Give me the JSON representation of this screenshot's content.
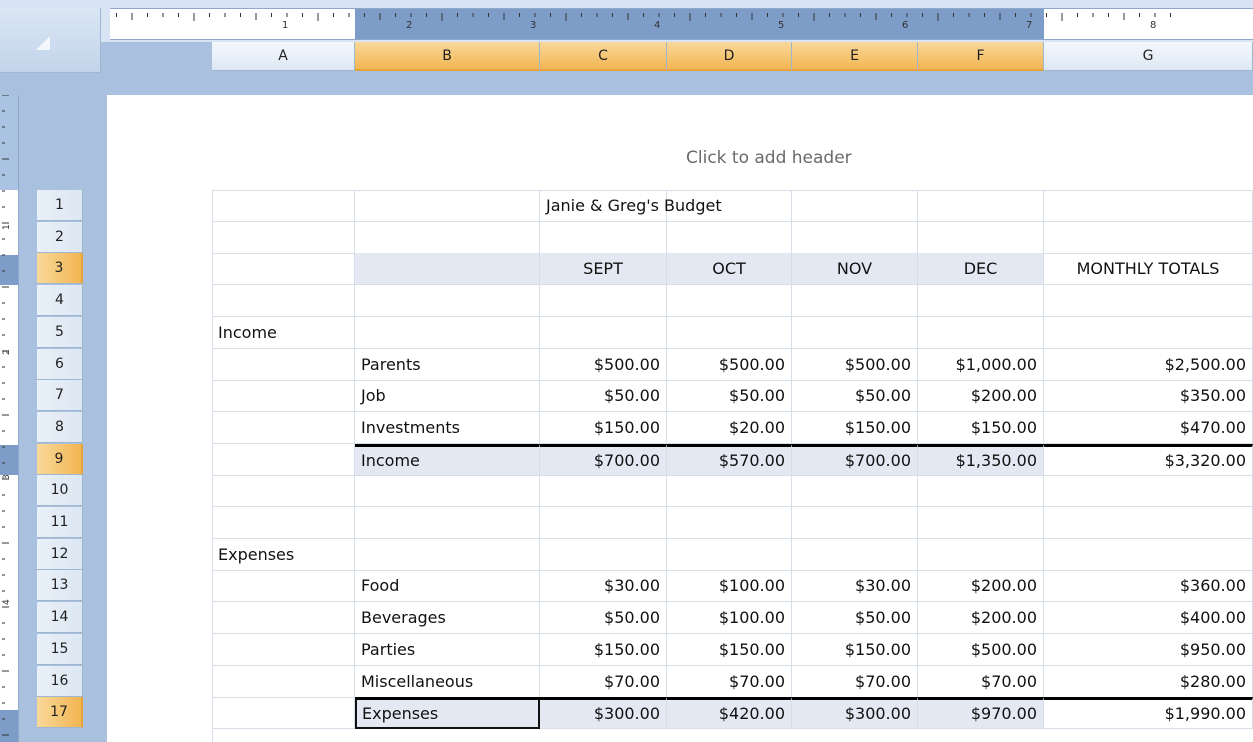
{
  "ruler": {
    "inch_marks": [
      "1",
      "2",
      "3",
      "4",
      "5",
      "6",
      "7",
      "8"
    ],
    "vertical_marks": [
      "1",
      "2",
      "3",
      "4"
    ]
  },
  "columns": [
    {
      "label": "A",
      "selected": false
    },
    {
      "label": "B",
      "selected": true
    },
    {
      "label": "C",
      "selected": true
    },
    {
      "label": "D",
      "selected": true
    },
    {
      "label": "E",
      "selected": true
    },
    {
      "label": "F",
      "selected": true
    },
    {
      "label": "G",
      "selected": false
    }
  ],
  "header_placeholder": "Click to add header",
  "selected_rows": [
    3,
    9,
    17
  ],
  "rows": [
    {
      "n": "1",
      "cells": [
        "",
        "",
        "Janie & Greg's Budget",
        "",
        "",
        "",
        ""
      ]
    },
    {
      "n": "2",
      "cells": [
        "",
        "",
        "",
        "",
        "",
        "",
        ""
      ]
    },
    {
      "n": "3",
      "cells": [
        "",
        "",
        "SEPT",
        "OCT",
        "NOV",
        "DEC",
        "MONTHLY TOTALS"
      ]
    },
    {
      "n": "4",
      "cells": [
        "",
        "",
        "",
        "",
        "",
        "",
        ""
      ]
    },
    {
      "n": "5",
      "cells": [
        "Income",
        "",
        "",
        "",
        "",
        "",
        ""
      ]
    },
    {
      "n": "6",
      "cells": [
        "",
        "Parents",
        "$500.00",
        "$500.00",
        "$500.00",
        "$1,000.00",
        "$2,500.00"
      ]
    },
    {
      "n": "7",
      "cells": [
        "",
        "Job",
        "$50.00",
        "$50.00",
        "$50.00",
        "$200.00",
        "$350.00"
      ]
    },
    {
      "n": "8",
      "cells": [
        "",
        "Investments",
        "$150.00",
        "$20.00",
        "$150.00",
        "$150.00",
        "$470.00"
      ]
    },
    {
      "n": "9",
      "cells": [
        "",
        "Income",
        "$700.00",
        "$570.00",
        "$700.00",
        "$1,350.00",
        "$3,320.00"
      ]
    },
    {
      "n": "10",
      "cells": [
        "",
        "",
        "",
        "",
        "",
        "",
        ""
      ]
    },
    {
      "n": "11",
      "cells": [
        "",
        "",
        "",
        "",
        "",
        "",
        ""
      ]
    },
    {
      "n": "12",
      "cells": [
        "Expenses",
        "",
        "",
        "",
        "",
        "",
        ""
      ]
    },
    {
      "n": "13",
      "cells": [
        "",
        "Food",
        "$30.00",
        "$100.00",
        "$30.00",
        "$200.00",
        "$360.00"
      ]
    },
    {
      "n": "14",
      "cells": [
        "",
        "Beverages",
        "$50.00",
        "$100.00",
        "$50.00",
        "$200.00",
        "$400.00"
      ]
    },
    {
      "n": "15",
      "cells": [
        "",
        "Parties",
        "$150.00",
        "$150.00",
        "$150.00",
        "$500.00",
        "$950.00"
      ]
    },
    {
      "n": "16",
      "cells": [
        "",
        "Miscellaneous",
        "$70.00",
        "$70.00",
        "$70.00",
        "$70.00",
        "$280.00"
      ]
    },
    {
      "n": "17",
      "cells": [
        "",
        "Expenses",
        "$300.00",
        "$420.00",
        "$300.00",
        "$970.00",
        "$1,990.00"
      ]
    }
  ],
  "colors": {
    "selection_orange": "#f2b552",
    "shade": "#e3e8f2",
    "frame_blue": "#a9c0de"
  }
}
